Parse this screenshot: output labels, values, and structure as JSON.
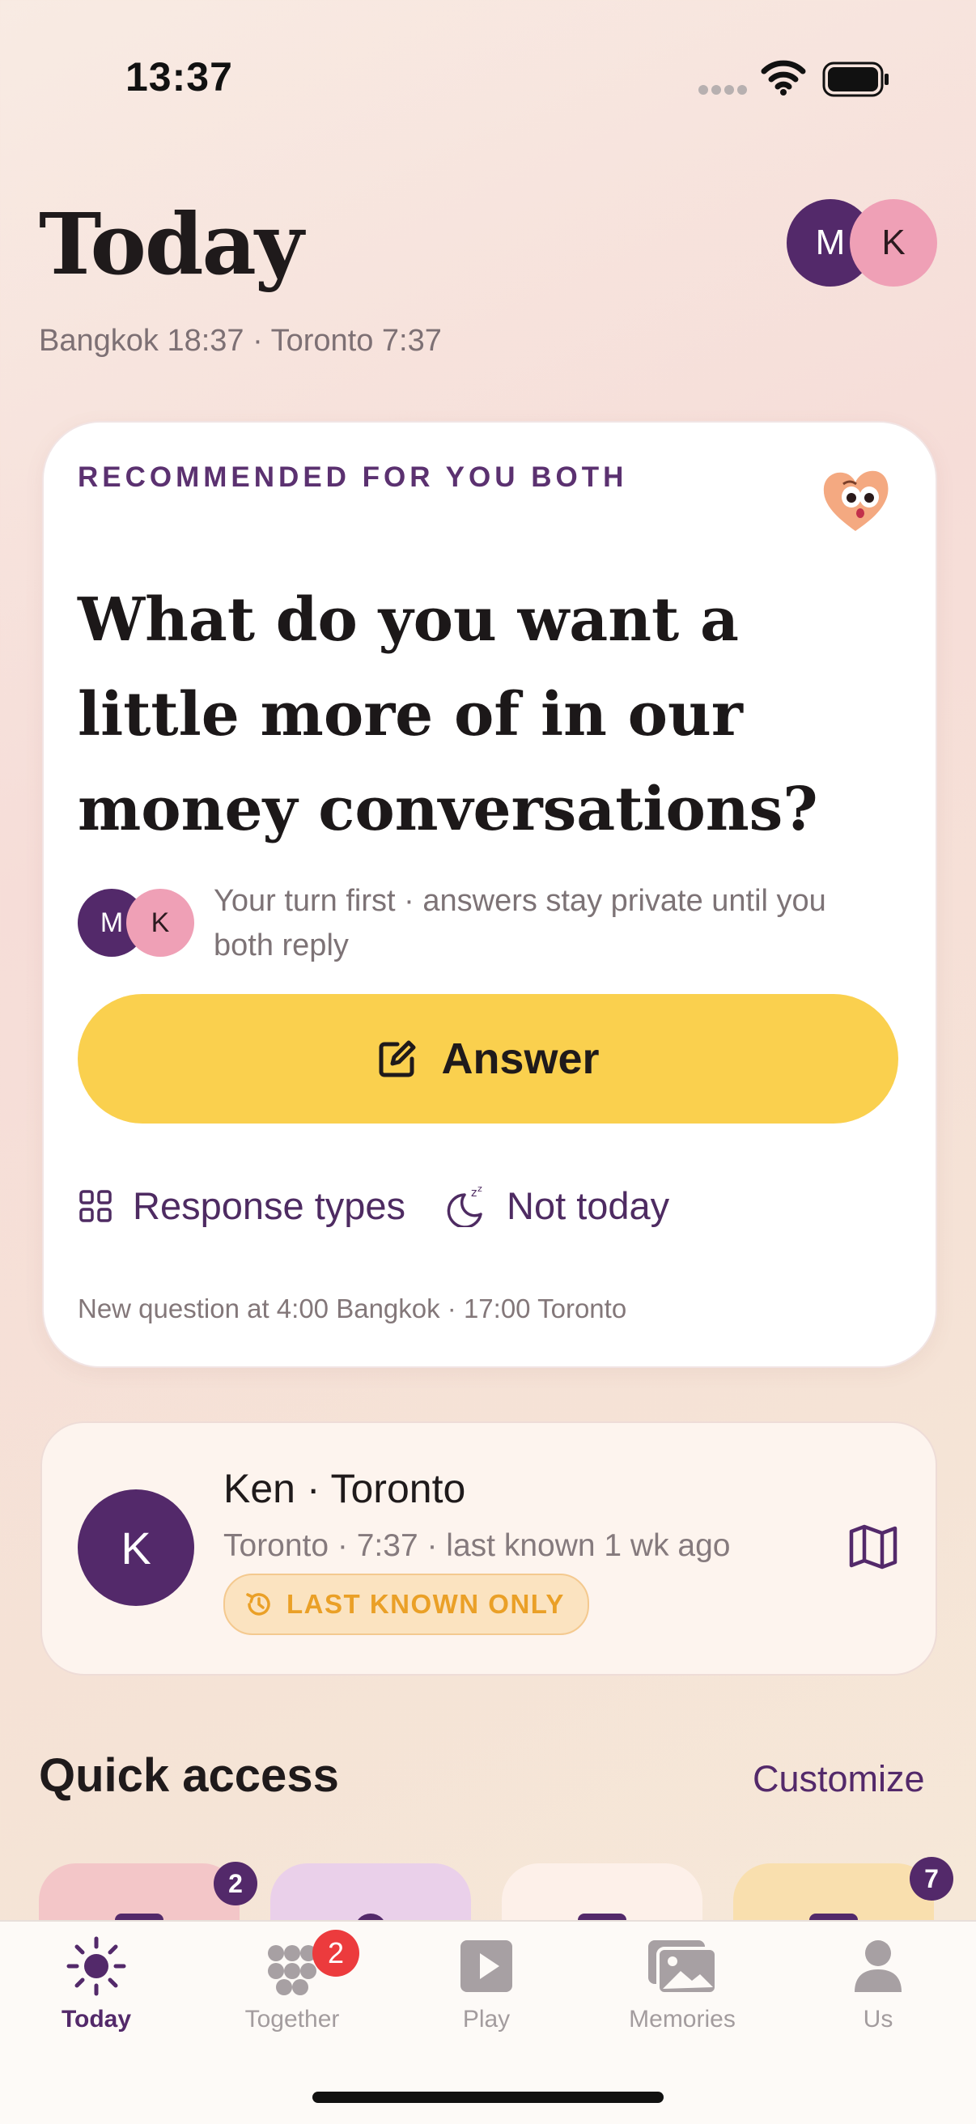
{
  "status_bar": {
    "time": "13:37"
  },
  "header": {
    "title": "Today",
    "subtitle": "Bangkok 18:37 · Toronto 7:37",
    "avatars": [
      "M",
      "K"
    ]
  },
  "question_card": {
    "label": "RECOMMENDED FOR YOU BOTH",
    "question": "What do you want a little more of in our money conversations?",
    "avatars": [
      "M",
      "K"
    ],
    "turn_note": "Your turn first · answers stay private until you both reply",
    "answer_label": "Answer",
    "response_types_label": "Response types",
    "not_today_label": "Not today",
    "schedule_note": "New question at 4:00 Bangkok · 17:00 Toronto"
  },
  "location_card": {
    "avatar": "K",
    "name": "Ken · Toronto",
    "detail": "Toronto · 7:37 · last known 1 wk ago",
    "badge": "LAST KNOWN ONLY"
  },
  "quick_access": {
    "title": "Quick access",
    "customize_label": "Customize",
    "tiles": [
      {
        "color": "#f3c6c8",
        "badge": "2"
      },
      {
        "color": "#ead0ea",
        "badge": ""
      },
      {
        "color": "#fdf0e9",
        "badge": ""
      },
      {
        "color": "#f9dfae",
        "badge": "7"
      }
    ]
  },
  "tab_bar": {
    "tabs": [
      {
        "label": "Today",
        "icon": "sun-icon",
        "active": true
      },
      {
        "label": "Together",
        "icon": "dots-cluster-icon",
        "badge": "2"
      },
      {
        "label": "Play",
        "icon": "play-icon"
      },
      {
        "label": "Memories",
        "icon": "photos-icon"
      },
      {
        "label": "Us",
        "icon": "person-icon"
      }
    ]
  },
  "colors": {
    "accent_purple": "#53296a",
    "answer_yellow": "#fad04e",
    "avatar_pink": "#efa0b6",
    "badge_orange": "#eaa027",
    "notification_red": "#ec3b3d"
  }
}
